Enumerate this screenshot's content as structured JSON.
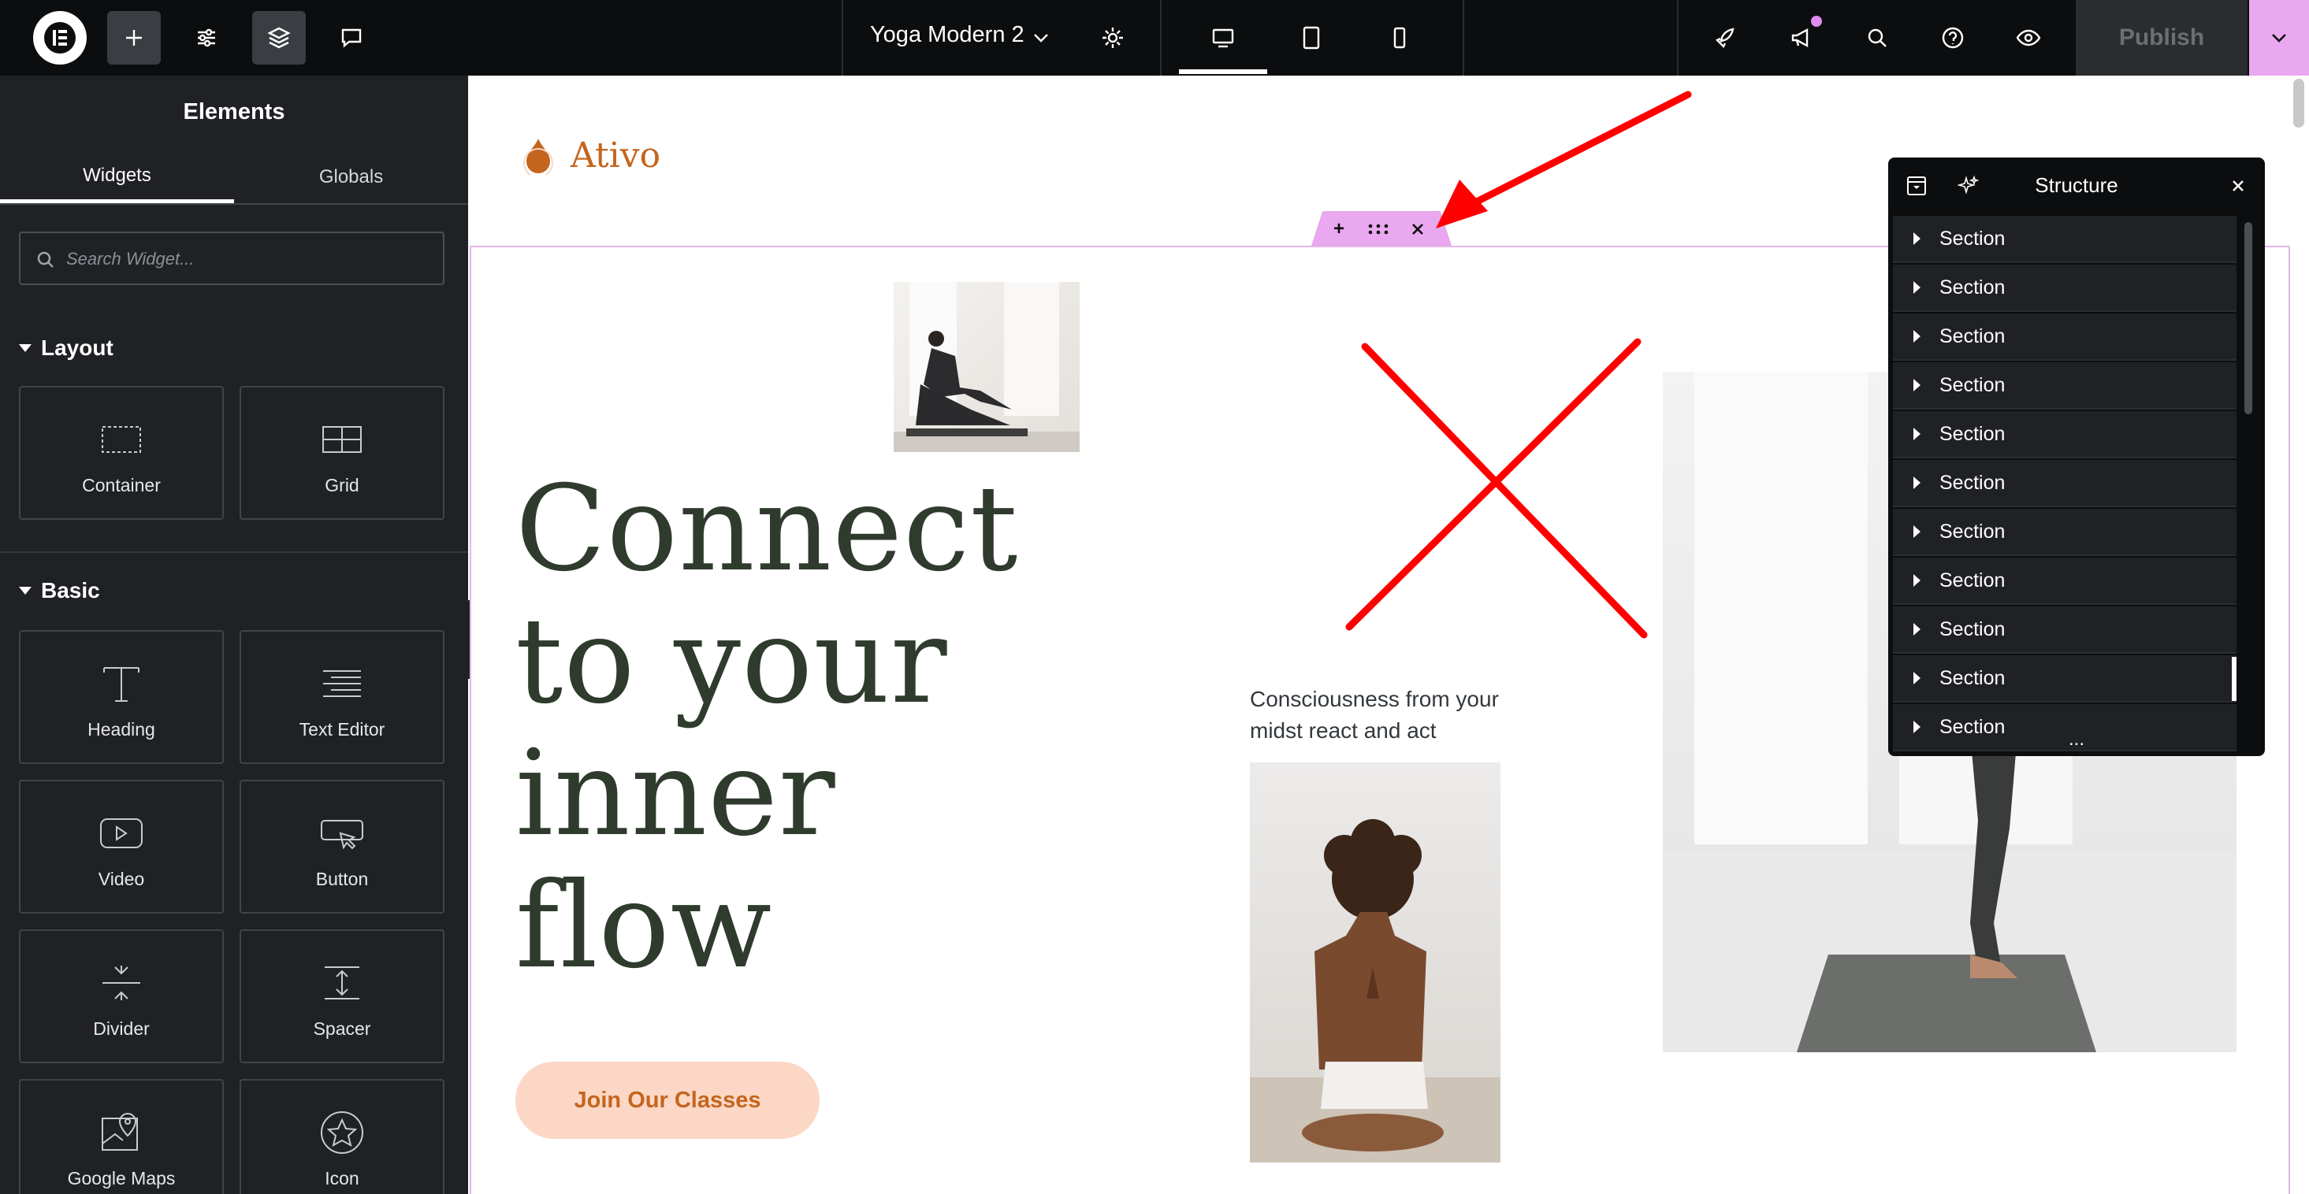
{
  "topbar": {
    "doc_title": "Yoga Modern 2",
    "publish_label": "Publish",
    "icons": [
      "elementor-logo-icon",
      "add-icon",
      "settings-sliders-icon",
      "layers-icon",
      "comments-icon",
      "chevron-down-icon",
      "gear-icon",
      "desktop-icon",
      "tablet-icon",
      "mobile-icon",
      "rocket-icon",
      "megaphone-icon",
      "search-icon",
      "help-icon",
      "eye-icon",
      "chevron-down-icon"
    ]
  },
  "panel": {
    "title": "Elements",
    "tabs": [
      "Widgets",
      "Globals"
    ],
    "search_placeholder": "Search Widget...",
    "categories": {
      "layout": "Layout",
      "basic": "Basic"
    },
    "widgets": {
      "container": "Container",
      "grid": "Grid",
      "heading": "Heading",
      "text_editor": "Text Editor",
      "video": "Video",
      "button": "Button",
      "divider": "Divider",
      "spacer": "Spacer",
      "google_maps": "Google Maps",
      "icon": "Icon"
    }
  },
  "page": {
    "brand": "Ativo",
    "headline": [
      "Connect",
      "to your",
      "inner",
      "flow"
    ],
    "cta": "Join Our Classes",
    "caption": "Consciousness from your midst react and act"
  },
  "structure": {
    "title": "Structure",
    "items": [
      "Section",
      "Section",
      "Section",
      "Section",
      "Section",
      "Section",
      "Section",
      "Section",
      "Section",
      "Section",
      "Section"
    ],
    "more": "..."
  },
  "colors": {
    "accent": "#c4651e",
    "editor_pink": "#e9a8f0",
    "annotation_red": "#ff0000"
  }
}
